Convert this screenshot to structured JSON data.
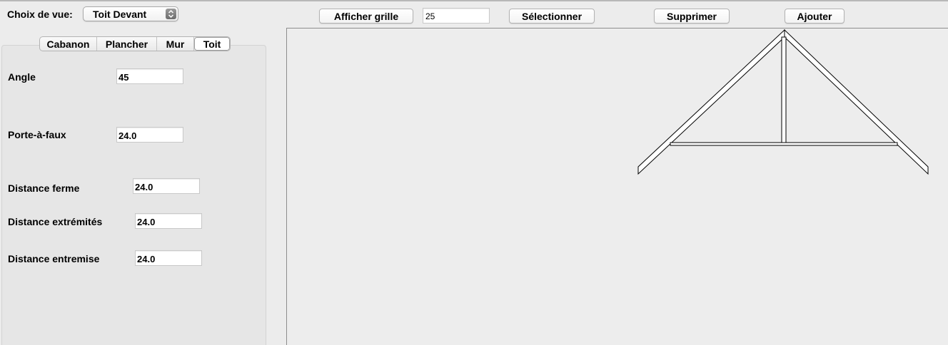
{
  "header": {
    "view_label": "Choix de vue:",
    "view_value": "Toit Devant",
    "grid_button": "Afficher grille",
    "grid_value": "25",
    "select_button": "Sélectionner",
    "delete_button": "Supprimer",
    "add_button": "Ajouter"
  },
  "tabs": [
    {
      "label": "Cabanon",
      "active": false
    },
    {
      "label": "Plancher",
      "active": false
    },
    {
      "label": "Mur",
      "active": false
    },
    {
      "label": "Toit",
      "active": true
    }
  ],
  "fields": {
    "angle": {
      "label": "Angle",
      "value": "45"
    },
    "overhang": {
      "label": "Porte-à-faux",
      "value": "24.0"
    },
    "truss_distance": {
      "label": "Distance ferme",
      "value": "24.0"
    },
    "end_distance": {
      "label": "Distance extrémités",
      "value": "24.0"
    },
    "blocking_distance": {
      "label": "Distance entremise",
      "value": "24.0"
    }
  },
  "drawing": {
    "view": "front",
    "element": "roof truss"
  }
}
